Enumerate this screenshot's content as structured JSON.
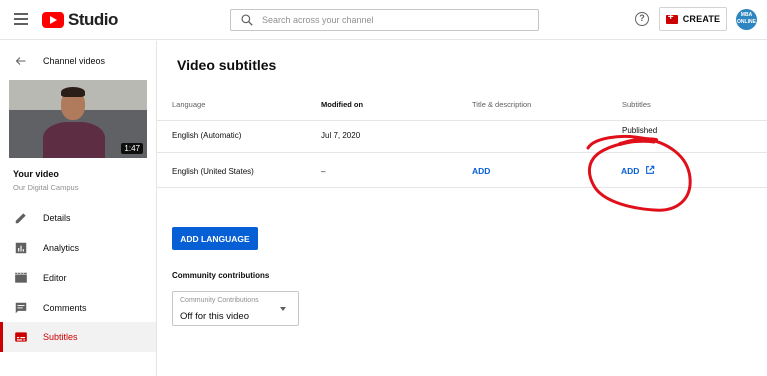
{
  "header": {
    "logo_text": "Studio",
    "search_placeholder": "Search across your channel",
    "help_glyph": "?",
    "create_label": "CREATE",
    "avatar_text": "MBA ONLINE"
  },
  "sidebar": {
    "back_label": "Channel videos",
    "video": {
      "duration": "1:47",
      "title": "Your video",
      "channel": "Our Digital Campus"
    },
    "items": [
      {
        "label": "Details",
        "icon": "pencil-icon"
      },
      {
        "label": "Analytics",
        "icon": "analytics-icon"
      },
      {
        "label": "Editor",
        "icon": "editor-icon"
      },
      {
        "label": "Comments",
        "icon": "comments-icon"
      },
      {
        "label": "Subtitles",
        "icon": "subtitles-icon",
        "active": true
      }
    ]
  },
  "main": {
    "title": "Video subtitles",
    "table": {
      "headers": [
        "Language",
        "Modified on",
        "Title & description",
        "Subtitles"
      ],
      "rows": [
        {
          "language": "English (Automatic)",
          "modified": "Jul 7, 2020",
          "title_desc": "",
          "subtitles": "Published"
        },
        {
          "language": "English (United States)",
          "modified": "–",
          "title_desc": "ADD",
          "subtitles": "ADD"
        }
      ]
    },
    "add_language_label": "ADD LANGUAGE",
    "community": {
      "heading": "Community contributions",
      "select_label": "Community Contributions",
      "select_value": "Off for this video"
    }
  },
  "colors": {
    "brand_red": "#ff0000",
    "accent_blue": "#065fd4",
    "active_red": "#cc0000",
    "annotation_red": "#e0101a"
  }
}
